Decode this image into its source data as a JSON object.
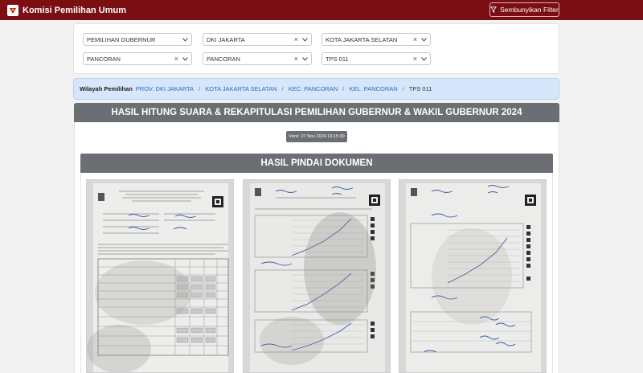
{
  "navbar": {
    "brand": "Komisi Pemilihan Umum",
    "filter_toggle": "Sembunyikan Filter"
  },
  "filters": [
    {
      "value": "PEMILIHAN GUBERNUR",
      "clearable": false
    },
    {
      "value": "DKI JAKARTA",
      "clearable": true
    },
    {
      "value": "KOTA JAKARTA SELATAN",
      "clearable": true
    },
    {
      "value": "PANCORAN",
      "clearable": true
    },
    {
      "value": "PANCORAN",
      "clearable": true
    },
    {
      "value": "TPS 011",
      "clearable": true
    }
  ],
  "breadcrumb": {
    "lead": "Wilayah Pemilihan",
    "links": [
      "PROV. DKI JAKARTA",
      "KOTA JAKARTA SELATAN",
      "KEC. PANCORAN",
      "KEL. PANCORAN"
    ],
    "current": "TPS 011",
    "separator": "/"
  },
  "main": {
    "title": "HASIL HITUNG SUARA & REKAPITULASI PEMILIHAN GUBERNUR & WAKIL GUBERNUR 2024",
    "version": "Versi: 27 Nov 2024 16:15:00",
    "scan_title": "HASIL PINDAI DOKUMEN"
  },
  "documents": [
    "scan-page-1",
    "scan-page-2",
    "scan-page-3"
  ],
  "colors": {
    "brand": "#7a0e13",
    "panel_header": "#6b6f73",
    "breadcrumb_bg": "#d7e7fb",
    "link": "#2a6bb8"
  }
}
